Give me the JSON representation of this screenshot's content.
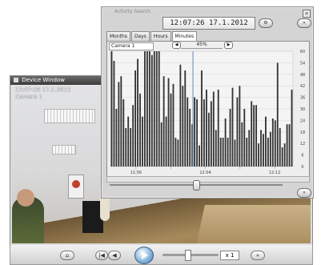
{
  "device_window": {
    "title": "Device Window",
    "overlay_timestamp": "12:07:26 17.1.2012",
    "overlay_camera": "Camera 1"
  },
  "playback": {
    "speed": "x 1"
  },
  "activity_search": {
    "title": "Activity Search",
    "time": "12:07:26 17.1.2012",
    "tabs": [
      "Months",
      "Days",
      "Hours",
      "Minutes"
    ],
    "active_tab": "Minutes",
    "camera": "Camera 1",
    "zoom": "45%",
    "icons": {
      "close": "close-icon",
      "settings": "settings-icon",
      "expand": "expand-icon"
    }
  },
  "chart_data": {
    "type": "bar",
    "title": "",
    "xlabel": "",
    "ylabel": "",
    "yticks": [
      0,
      6,
      12,
      18,
      24,
      30,
      36,
      42,
      48,
      54,
      60
    ],
    "ylim": [
      0,
      60
    ],
    "xticks": [
      "11:56",
      "",
      "12:04",
      "",
      "12:12"
    ],
    "bar_color": "#333333",
    "cursor_color": "#7a9cc6",
    "values": [
      60,
      55,
      30,
      44,
      47,
      35,
      20,
      26,
      20,
      32,
      50,
      56,
      38,
      26,
      61,
      61,
      61,
      58,
      60,
      61,
      61,
      23,
      47,
      26,
      46,
      38,
      43,
      15,
      14,
      53,
      42,
      50,
      36,
      30,
      22,
      36,
      35,
      11,
      50,
      35,
      40,
      28,
      34,
      39,
      19,
      40,
      15,
      15,
      25,
      15,
      30,
      41,
      14,
      36,
      42,
      23,
      30,
      15,
      19,
      34,
      32,
      32,
      12,
      19,
      17,
      26,
      15,
      18,
      25,
      24,
      54,
      20,
      10,
      12,
      22,
      22,
      40
    ]
  }
}
